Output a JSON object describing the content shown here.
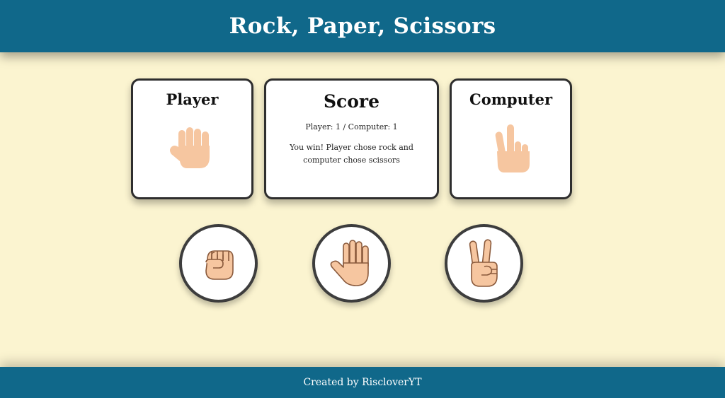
{
  "app": {
    "title": "Rock, Paper, Scissors"
  },
  "player_card": {
    "title": "Player",
    "choice_icon": "raised-fist-rock-icon"
  },
  "score_card": {
    "title": "Score",
    "score_text": "Player: 1 / Computer: 1",
    "result_text": "You win! Player chose rock and computer chose scissors"
  },
  "computer_card": {
    "title": "Computer",
    "choice_icon": "victory-hand-scissors-icon"
  },
  "choices": [
    {
      "name": "rock",
      "icon": "fist-icon"
    },
    {
      "name": "paper",
      "icon": "raised-hand-icon"
    },
    {
      "name": "scissors",
      "icon": "victory-hand-icon"
    }
  ],
  "footer": {
    "credit": "Created by RiscloverYT"
  },
  "colors": {
    "primary": "#10688a",
    "background": "#fbf4d0",
    "skin": "#f6c6a0",
    "skin_outline": "#9a6a4a"
  }
}
